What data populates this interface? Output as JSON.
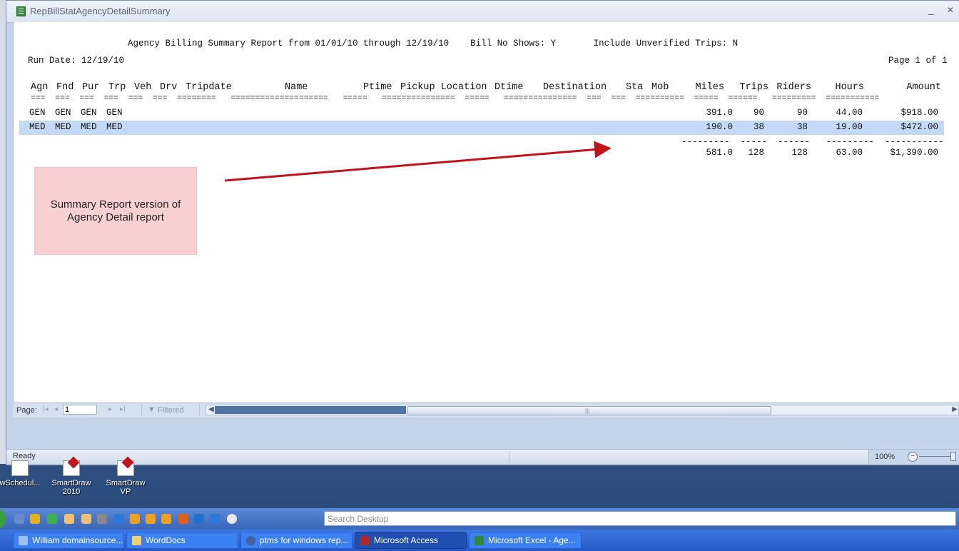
{
  "window": {
    "title": "RepBillStatAgencyDetailSummary",
    "minimize_glyph": "_",
    "close_glyph": "✕"
  },
  "report": {
    "header_line": "Agency Billing Summary Report from 01/01/10 through 12/19/10    Bill No Shows: Y       Include Unverified Trips: N",
    "run_date": "Run Date: 12/19/10",
    "page_info": "Page 1 of 1",
    "columns": [
      "Agn",
      "Fnd",
      "Pur",
      "Trp",
      "Veh",
      "Drv",
      "Tripdate",
      "Name",
      "Ptime",
      "Pickup Location",
      "Dtime",
      "Destination",
      "Sta",
      "Mob",
      "Miles",
      "Trips",
      "Riders",
      "Hours",
      "Amount"
    ],
    "underline_row": "===  ===  ===  ===  ===  ===  ========   ====================   =====   ===============  =====   ===============  ===  ===  ==========  =====  ======   =========  ===========",
    "rows": [
      {
        "agn": "GEN",
        "fnd": "GEN",
        "pur": "GEN",
        "trp": "GEN",
        "miles": "391.0",
        "trips": "90",
        "riders": "90",
        "hours": "44.00",
        "amount": "$918.00"
      },
      {
        "agn": "MED",
        "fnd": "MED",
        "pur": "MED",
        "trp": "MED",
        "miles": "190.0",
        "trips": "38",
        "riders": "38",
        "hours": "19.00",
        "amount": "$472.00"
      }
    ],
    "totals_rule": "---------  -----  ------   ---------  -----------",
    "totals": {
      "miles": "581.0",
      "trips": "128",
      "riders": "128",
      "hours": "63.00",
      "amount": "$1,390.00"
    }
  },
  "annotation": {
    "note_text": "Summary Report version of Agency Detail report",
    "note_color": "#f8d0d2",
    "arrow_color": "#c0141c"
  },
  "navigation": {
    "page_label": "Page:",
    "page_value": "1",
    "first_glyph": "|◂",
    "prev_glyph": "◂",
    "next_glyph": "▸",
    "last_glyph": "▸|",
    "filter_icon": "funnel-icon",
    "filter_label": "Filtered"
  },
  "status": {
    "text": "Ready",
    "zoom": "100%"
  },
  "desktop_icons": [
    {
      "label": "wSchedul..."
    },
    {
      "label": "SmartDraw 2010"
    },
    {
      "label": "SmartDraw VP"
    }
  ],
  "search": {
    "placeholder": "Search Desktop"
  },
  "taskbar": [
    {
      "label": "William domainsource..."
    },
    {
      "label": "WordDocs"
    },
    {
      "label": "ptms for windows rep..."
    },
    {
      "label": "Microsoft Access"
    },
    {
      "label": "Microsoft Excel - Age..."
    }
  ],
  "colors": {
    "selected_row": "#c3d9f5",
    "taskbar": "#2458c6"
  }
}
